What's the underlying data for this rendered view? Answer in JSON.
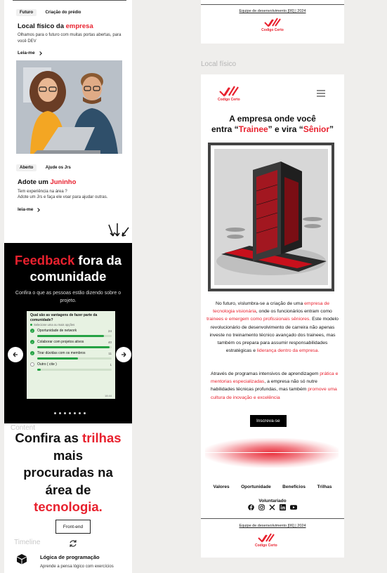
{
  "left": {
    "card1": {
      "tags": [
        "Futuro",
        "Criação do prédio"
      ],
      "title_prefix": "Local físico da ",
      "title_highlight": "empresa",
      "desc": "Olhamos para o futuro com muitas portas abertas, para você DEV",
      "read": "Leia-me"
    },
    "card2": {
      "tags": [
        "Aberto",
        "Ajude os Jrs"
      ],
      "title_prefix": "Adote um ",
      "title_highlight": "Juninho",
      "desc1": "Tem experiência na área ?",
      "desc2": "Adote um Jrs e faça ele voar para ajudar outras.",
      "read": "leia-me"
    },
    "feedback": {
      "title_highlight": "Feedback",
      "title_rest": " fora da comunidade",
      "subtitle": "Confira o que as pessoas estão dizendo sobre o projeto.",
      "poll": {
        "question": "Qual são as vantagens de fazer parte da comunidade?",
        "hint": "Selecione uma ou mais opções",
        "options": [
          {
            "label": "Oportunidade de network",
            "count": "24",
            "fill": 0.9
          },
          {
            "label": "Colaborar com projetos ativos",
            "count": "40",
            "fill": 0.97
          },
          {
            "label": "Tirar dúvidas com os membros",
            "count": "11",
            "fill": 0.55
          },
          {
            "label": "Outro ( cite )",
            "count": "1",
            "fill": 0.05
          }
        ],
        "time": "18:44"
      }
    },
    "content_label": "Content",
    "trilhas": {
      "l1a": "Confira as ",
      "l1b": "trilhas",
      "l2": "mais",
      "l3": "procuradas na",
      "l4": "área de",
      "l5": "tecnologia.",
      "button": "Front-end"
    },
    "timeline": {
      "label": "Timeline",
      "item_title": "Lógica de programação",
      "item_desc": "Aprende a pensa lógico com exercícios"
    }
  },
  "right": {
    "footer_top": {
      "copyright": "Equipe de desenvolvimento [06] | 2024"
    },
    "section_label": "Local físico",
    "logo_word": "Codigo Certo",
    "hero": {
      "l1": "A empresa onde você",
      "l2a": "entra “",
      "l2b": "Trainee",
      "l2c": "” e vira “",
      "l2d": "Sênior",
      "l2e": "”"
    },
    "p1": {
      "a": "No futuro, vislumbra-se a criação de uma ",
      "b": "empresa de tecnologia visionária",
      "c": ", onde os funcionários entram como ",
      "d": "trainees e emergem como profissionais sêniores.",
      "e": " Este modelo revolucionário de desenvolvimento de carreira não apenas investe no treinamento técnico avançado dos trainees, mas também os prepara para assumir responsabilidades estratégicas e ",
      "f": "liderança dentro da empresa."
    },
    "p2": {
      "a": "Através de programas intensivos de aprendizagem ",
      "b": "prática e mentorias especializadas",
      "c": ", a empresa não só nutre habilidades técnicas profundas, mas também ",
      "d": "promove uma cultura de inovação e excelência"
    },
    "cta": "Inscreva-se",
    "nav": [
      "Valores",
      "Oportunidade",
      "Benefícios",
      "Trilhas",
      "Voluntariado"
    ],
    "footer_bottom": {
      "copyright": "Equipe de desenvolvimento [06] | 2024"
    }
  },
  "colors": {
    "accent": "#e8212e",
    "green": "#25a244",
    "dark": "#000000"
  },
  "icons": [
    "chevron-right-icon",
    "arrows-down-icon",
    "arrow-left-icon",
    "arrow-right-icon",
    "sync-icon",
    "cube-icon",
    "menu-icon",
    "facebook-icon",
    "instagram-icon",
    "x-icon",
    "linkedin-icon",
    "youtube-icon"
  ]
}
